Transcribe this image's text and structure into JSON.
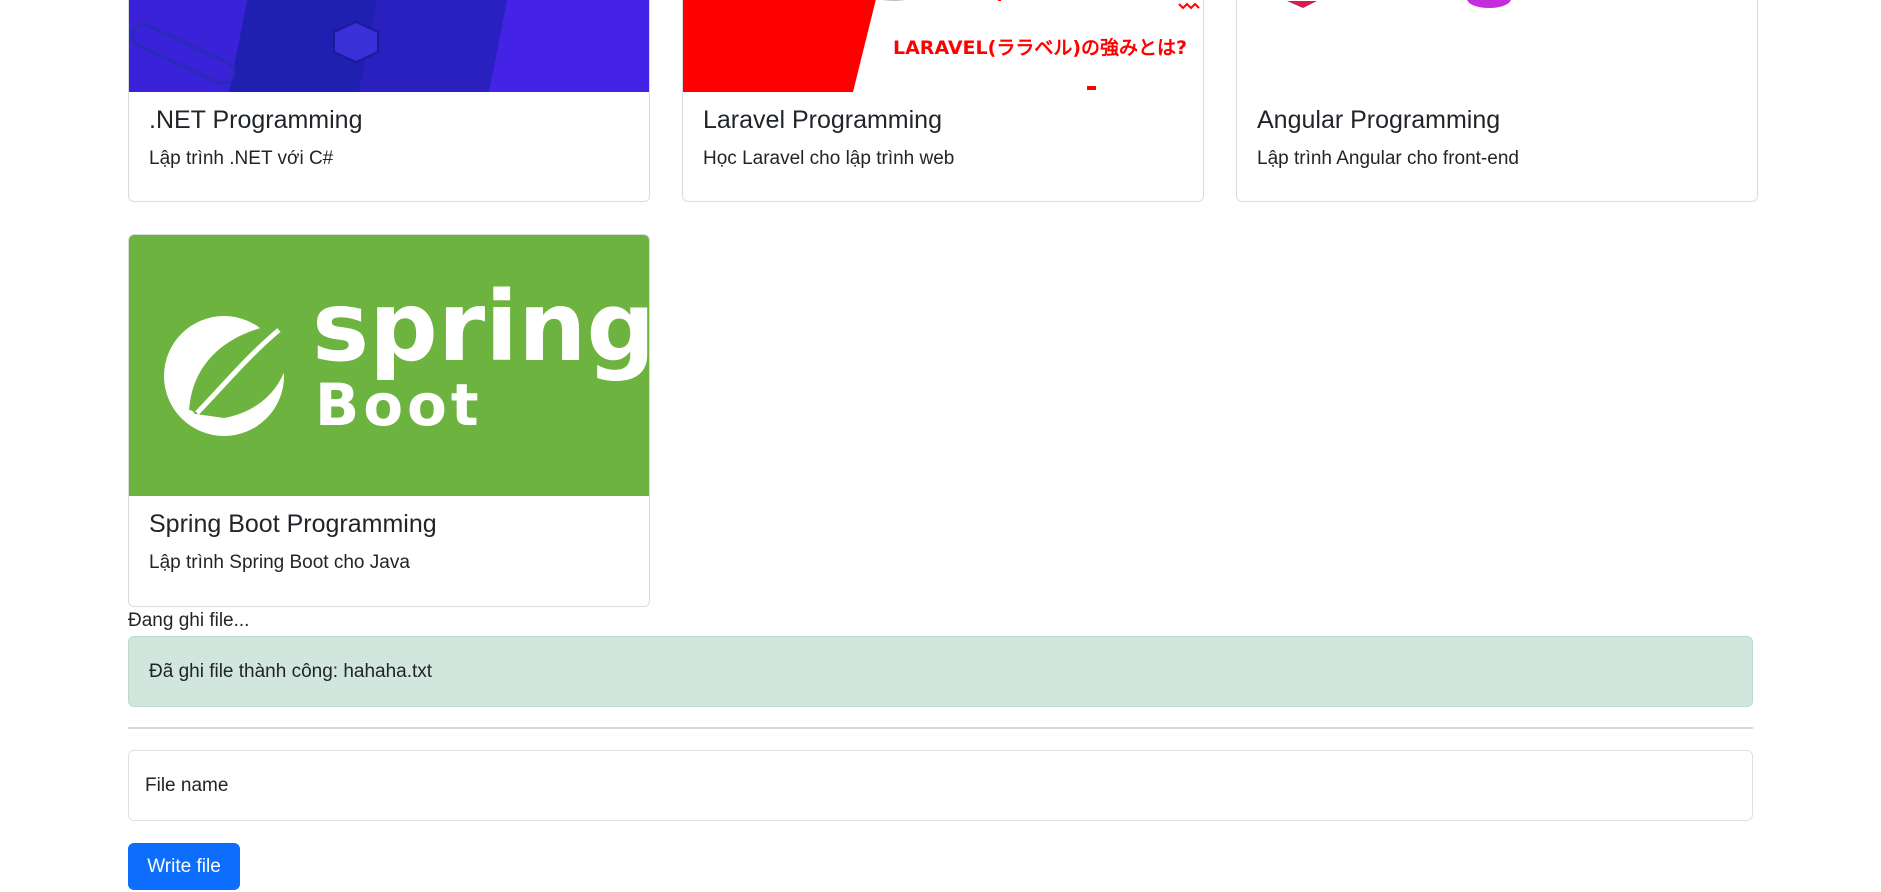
{
  "courses": [
    {
      "title": ".NET Programming",
      "description": "Lập trình .NET với C#"
    },
    {
      "title": "Laravel Programming",
      "description": "Học Laravel cho lập trình web",
      "image_text": "LARAVEL(ララベル)の強みとは?"
    },
    {
      "title": "Angular Programming",
      "description": "Lập trình Angular cho front-end"
    },
    {
      "title": "Spring Boot Programming",
      "description": "Lập trình Spring Boot cho Java",
      "image_text_1": "spring",
      "image_text_2": "Boot"
    }
  ],
  "status": {
    "writing": "Đang ghi file..."
  },
  "alert": {
    "message": "Đã ghi file thành công: hahaha.txt"
  },
  "form": {
    "filename_placeholder": "File name",
    "submit_label": "Write file"
  },
  "colors": {
    "primary": "#0d6efd",
    "success_bg": "#d1e7dd",
    "spring_green": "#6db33f",
    "laravel_red": "#ff0000",
    "dotnet_purple": "#3d1fd6"
  }
}
